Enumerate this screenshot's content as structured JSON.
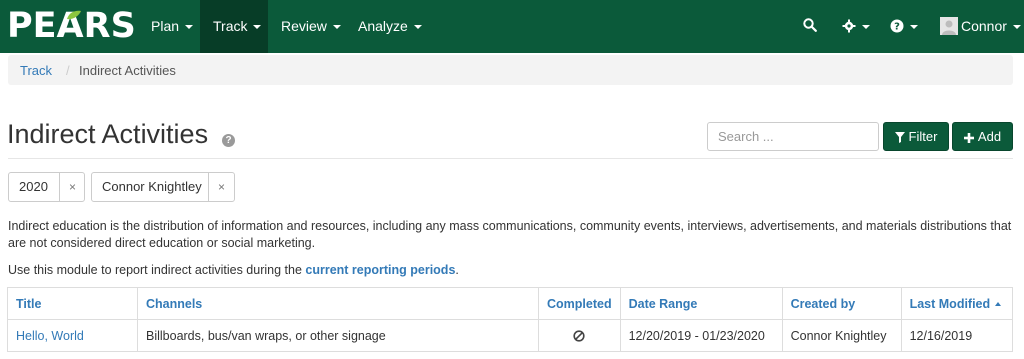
{
  "brand": {
    "logo_text": "PEARS",
    "accent": "#0b5a3a",
    "link_color": "#337ab7"
  },
  "nav": {
    "items": [
      {
        "label": "Plan",
        "active": false
      },
      {
        "label": "Track",
        "active": true
      },
      {
        "label": "Review",
        "active": false
      },
      {
        "label": "Analyze",
        "active": false
      }
    ],
    "right": {
      "search_icon": "search-icon",
      "settings_icon": "gear-icon",
      "help_icon": "question-circle-icon",
      "user_label": "Connor"
    }
  },
  "breadcrumb": {
    "parent": "Track",
    "current": "Indirect Activities"
  },
  "page": {
    "title": "Indirect Activities",
    "search_placeholder": "Search ...",
    "filter_label": "Filter",
    "add_label": "Add"
  },
  "filters": [
    {
      "label": "2020",
      "remove": "×"
    },
    {
      "label": "Connor Knightley",
      "remove": "×"
    }
  ],
  "description": {
    "line1": "Indirect education is the distribution of information and resources, including any mass communications, community events, interviews, advertisements, and materials distributions that",
    "line2": "are not considered direct education or social marketing.",
    "line3_prefix": "Use this module to report indirect activities during the ",
    "line3_link": "current reporting periods",
    "line3_suffix": "."
  },
  "table": {
    "columns": [
      "Title",
      "Channels",
      "Completed",
      "Date Range",
      "Created by",
      "Last Modified"
    ],
    "sorted_column": "Last Modified",
    "rows": [
      {
        "title": "Hello, World",
        "channels": "Billboards, bus/van wraps, or other signage",
        "completed": "not-completed-icon",
        "date_range": "12/20/2019 - 01/23/2020",
        "created_by": "Connor Knightley",
        "last_modified": "12/16/2019"
      }
    ]
  }
}
